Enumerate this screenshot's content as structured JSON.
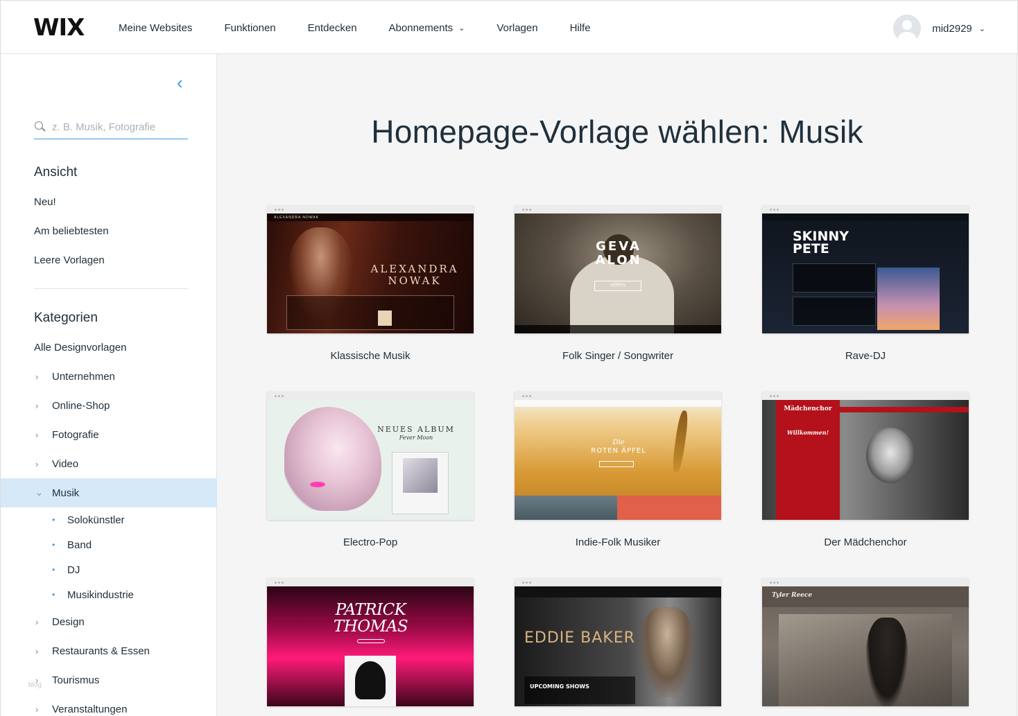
{
  "header": {
    "logo": "WIX",
    "nav": [
      {
        "label": "Meine Websites"
      },
      {
        "label": "Funktionen"
      },
      {
        "label": "Entdecken"
      },
      {
        "label": "Abonnements",
        "dropdown": true
      },
      {
        "label": "Vorlagen"
      },
      {
        "label": "Hilfe"
      }
    ],
    "user": {
      "name": "mid2929"
    }
  },
  "sidebar": {
    "search_placeholder": "z. B. Musik, Fotografie",
    "view_title": "Ansicht",
    "view_links": [
      "Neu!",
      "Am beliebtesten",
      "Leere Vorlagen"
    ],
    "categories_title": "Kategorien",
    "all_templates": "Alle Designvorlagen",
    "categories": [
      {
        "label": "Unternehmen"
      },
      {
        "label": "Online-Shop"
      },
      {
        "label": "Fotografie"
      },
      {
        "label": "Video"
      },
      {
        "label": "Musik",
        "expanded": true
      }
    ],
    "subcategories": [
      "Solokünstler",
      "Band",
      "DJ",
      "Musikindustrie"
    ],
    "more_categories": [
      {
        "label": "Design"
      },
      {
        "label": "Restaurants & Essen"
      },
      {
        "label": "Tourismus"
      },
      {
        "label": "Veranstaltungen"
      }
    ],
    "watermark": "blog"
  },
  "main": {
    "title": "Homepage-Vorlage wählen: Musik",
    "templates": [
      {
        "label": "Klassische Musik",
        "preview_title": "ALEXANDRA NOWAK",
        "site_name": "ALEXANDRA NOWAK"
      },
      {
        "label": "Folk Singer / Songwriter",
        "preview_title": "GEVA ALON",
        "button": "HÖREN"
      },
      {
        "label": "Rave-DJ",
        "preview_title": "SKINNY PETE"
      },
      {
        "label": "Electro-Pop",
        "preview_title": "NEUES ALBUM",
        "preview_sub": "Fever Moon"
      },
      {
        "label": "Indie-Folk Musiker",
        "preview_title": "ROTEN ÄPFEL",
        "preview_kicker": "Die"
      },
      {
        "label": "Der Mädchenchor",
        "preview_title": "Mädchenchor",
        "preview_sub": "Willkommen!"
      },
      {
        "label": "Patrick Thomas",
        "preview_title": "PATRICK THOMAS"
      },
      {
        "label": "Eddie Baker",
        "preview_title": "EDDIE BAKER",
        "preview_sub": "UPCOMING SHOWS"
      },
      {
        "label": "Tyler Reece",
        "preview_title": "Tyler Reece"
      }
    ]
  },
  "colors": {
    "accent": "#3899ec",
    "active_bg": "#d6e9f8",
    "text": "#20303c",
    "main_bg": "#f5f5f5"
  }
}
